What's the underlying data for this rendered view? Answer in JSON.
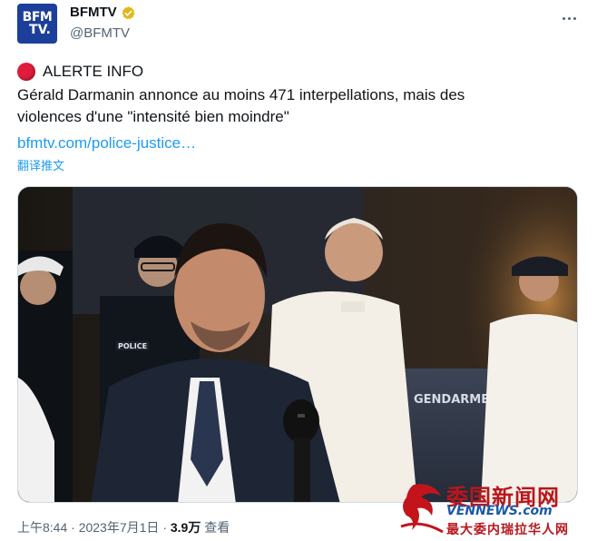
{
  "account": {
    "avatar_line1": "BFM",
    "avatar_line2": "TV.",
    "display_name": "BFMTV",
    "handle": "@BFMTV"
  },
  "tweet": {
    "alert_label": "ALERTE INFO",
    "text_line1": "Gérald Darmanin annonce au moins 471 interpellations, mais des",
    "text_line2": "violences d'une \"intensité bien moindre\"",
    "link_text": "bfmtv.com/police-justice…",
    "translate_label": "翻译推文"
  },
  "media": {
    "van_label": "GENDARMERIE",
    "badge_text": "POLICE"
  },
  "meta": {
    "time": "上午8:44",
    "separator": "·",
    "date": "2023年7月1日",
    "views_count": "3.9万",
    "views_label": "查看"
  },
  "watermark": {
    "title": "委国新闻网",
    "slogan": "最大委内瑞拉华人网",
    "domain": "VENNEWS.com"
  },
  "colors": {
    "link": "#1d9bf0",
    "alert_dot": "#e01c3c",
    "secondary_text": "#536471",
    "avatar_bg": "#1c3f9b",
    "verified_badge": "#e2b719"
  }
}
